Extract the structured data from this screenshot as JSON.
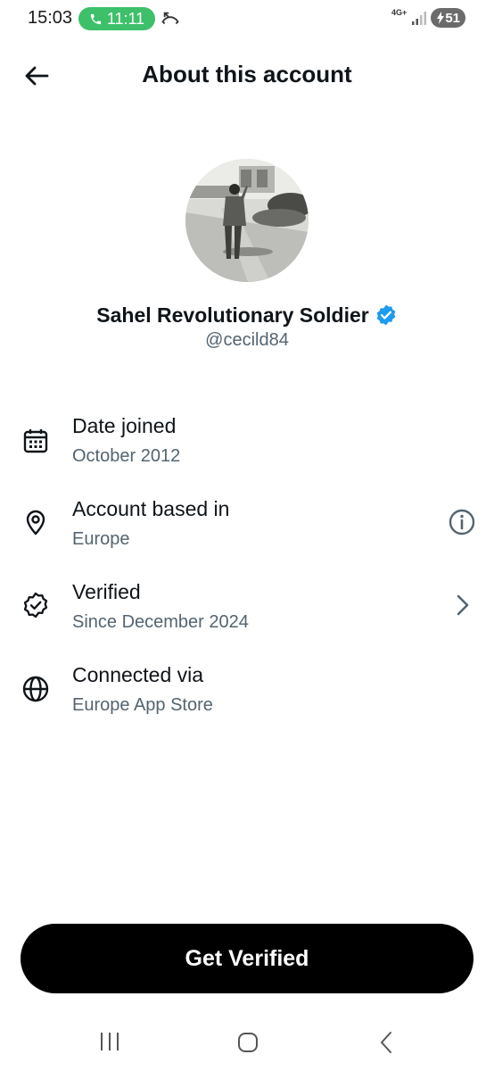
{
  "status_bar": {
    "time": "15:03",
    "call_time": "11:11",
    "network": "4G+",
    "battery": "51"
  },
  "header": {
    "title": "About this account"
  },
  "profile": {
    "name": "Sahel Revolutionary Soldier",
    "handle": "@cecild84",
    "verified_color": "#1d9bf0"
  },
  "rows": [
    {
      "icon": "calendar-icon",
      "title": "Date joined",
      "subtitle": "October 2012"
    },
    {
      "icon": "location-pin-icon",
      "title": "Account based in",
      "subtitle": "Europe",
      "trailing": "info-icon"
    },
    {
      "icon": "verified-badge-icon",
      "title": "Verified",
      "subtitle": "Since December 2024",
      "trailing": "chevron-right-icon"
    },
    {
      "icon": "globe-icon",
      "title": "Connected via",
      "subtitle": "Europe App Store"
    }
  ],
  "cta": {
    "label": "Get Verified"
  },
  "colors": {
    "text": "#0f1419",
    "secondary": "#536471",
    "call_green": "#3ec06a",
    "button_bg": "#000000"
  }
}
